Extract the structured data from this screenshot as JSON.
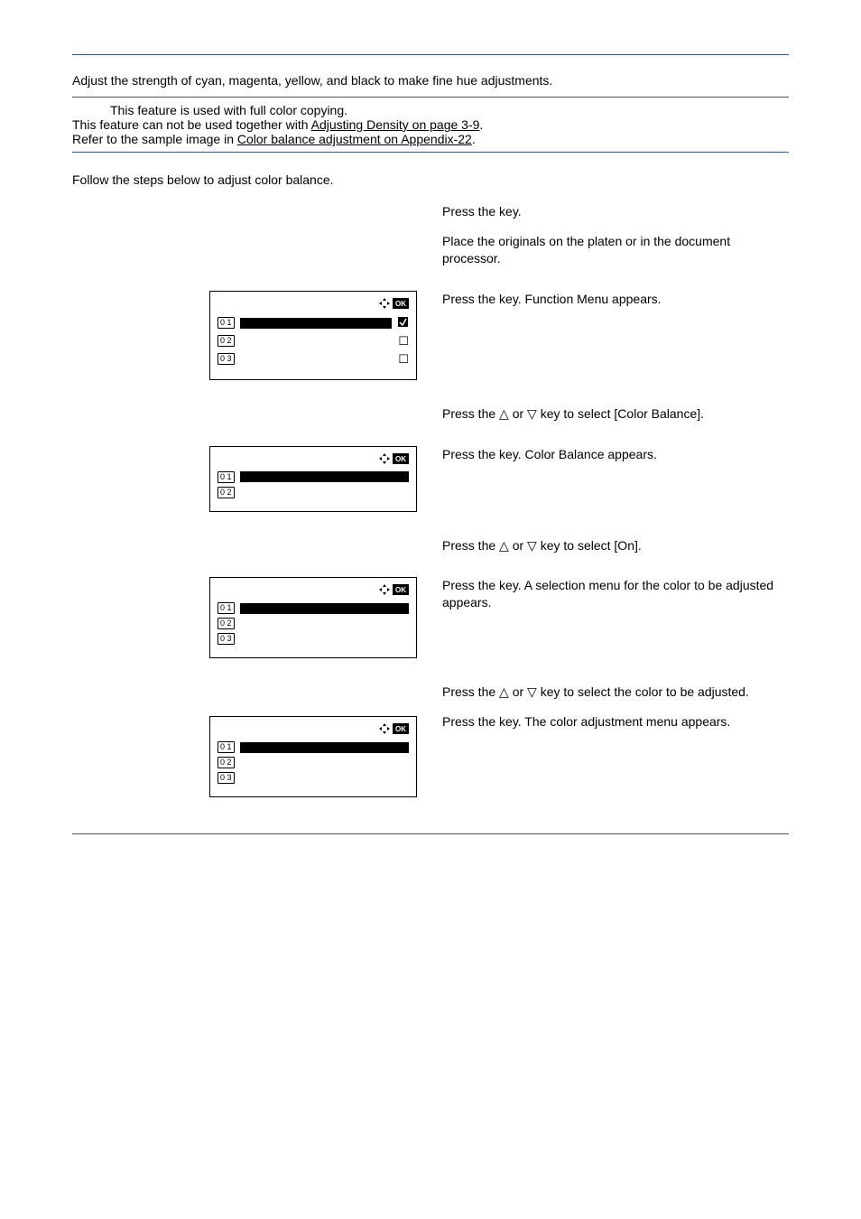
{
  "intro": "Adjust the strength of cyan, magenta, yellow, and black to make fine hue adjustments.",
  "note": {
    "line1": "This feature is used with full color copying.",
    "line2_pre": "This feature can not be used together with ",
    "line2_link": "Adjusting Density on page 3-9",
    "line2_post": ".",
    "line3_pre": "Refer to the sample image in ",
    "line3_link": "Color balance adjustment on Appendix-22",
    "line3_post": "."
  },
  "follow": "Follow the steps below to adjust color balance.",
  "steps": {
    "s1": {
      "a": "Press the ",
      "b": " key."
    },
    "s2": "Place the originals on the platen or in the document processor.",
    "s3": {
      "a": "Press the ",
      "b": " key. Function Menu appears."
    },
    "s4_pre": "Press the ",
    "s4_mid": " or ",
    "s4_post": " key to select [Color Balance].",
    "s5": {
      "a": "Press the ",
      "b": " key. Color Balance appears."
    },
    "s6_pre": "Press the ",
    "s6_mid": " or ",
    "s6_post": " key to select [On].",
    "s7": {
      "a": "Press the ",
      "b": " key. A selection menu for the color to be adjusted appears."
    },
    "s8_pre": "Press the ",
    "s8_mid": " or ",
    "s8_post": " key to select the color to be adjusted.",
    "s9": {
      "a": "Press the ",
      "b": " key. The color adjustment menu appears."
    }
  },
  "lcd": {
    "n1": "0 1",
    "n2": "0 2",
    "n3": "0 3"
  }
}
